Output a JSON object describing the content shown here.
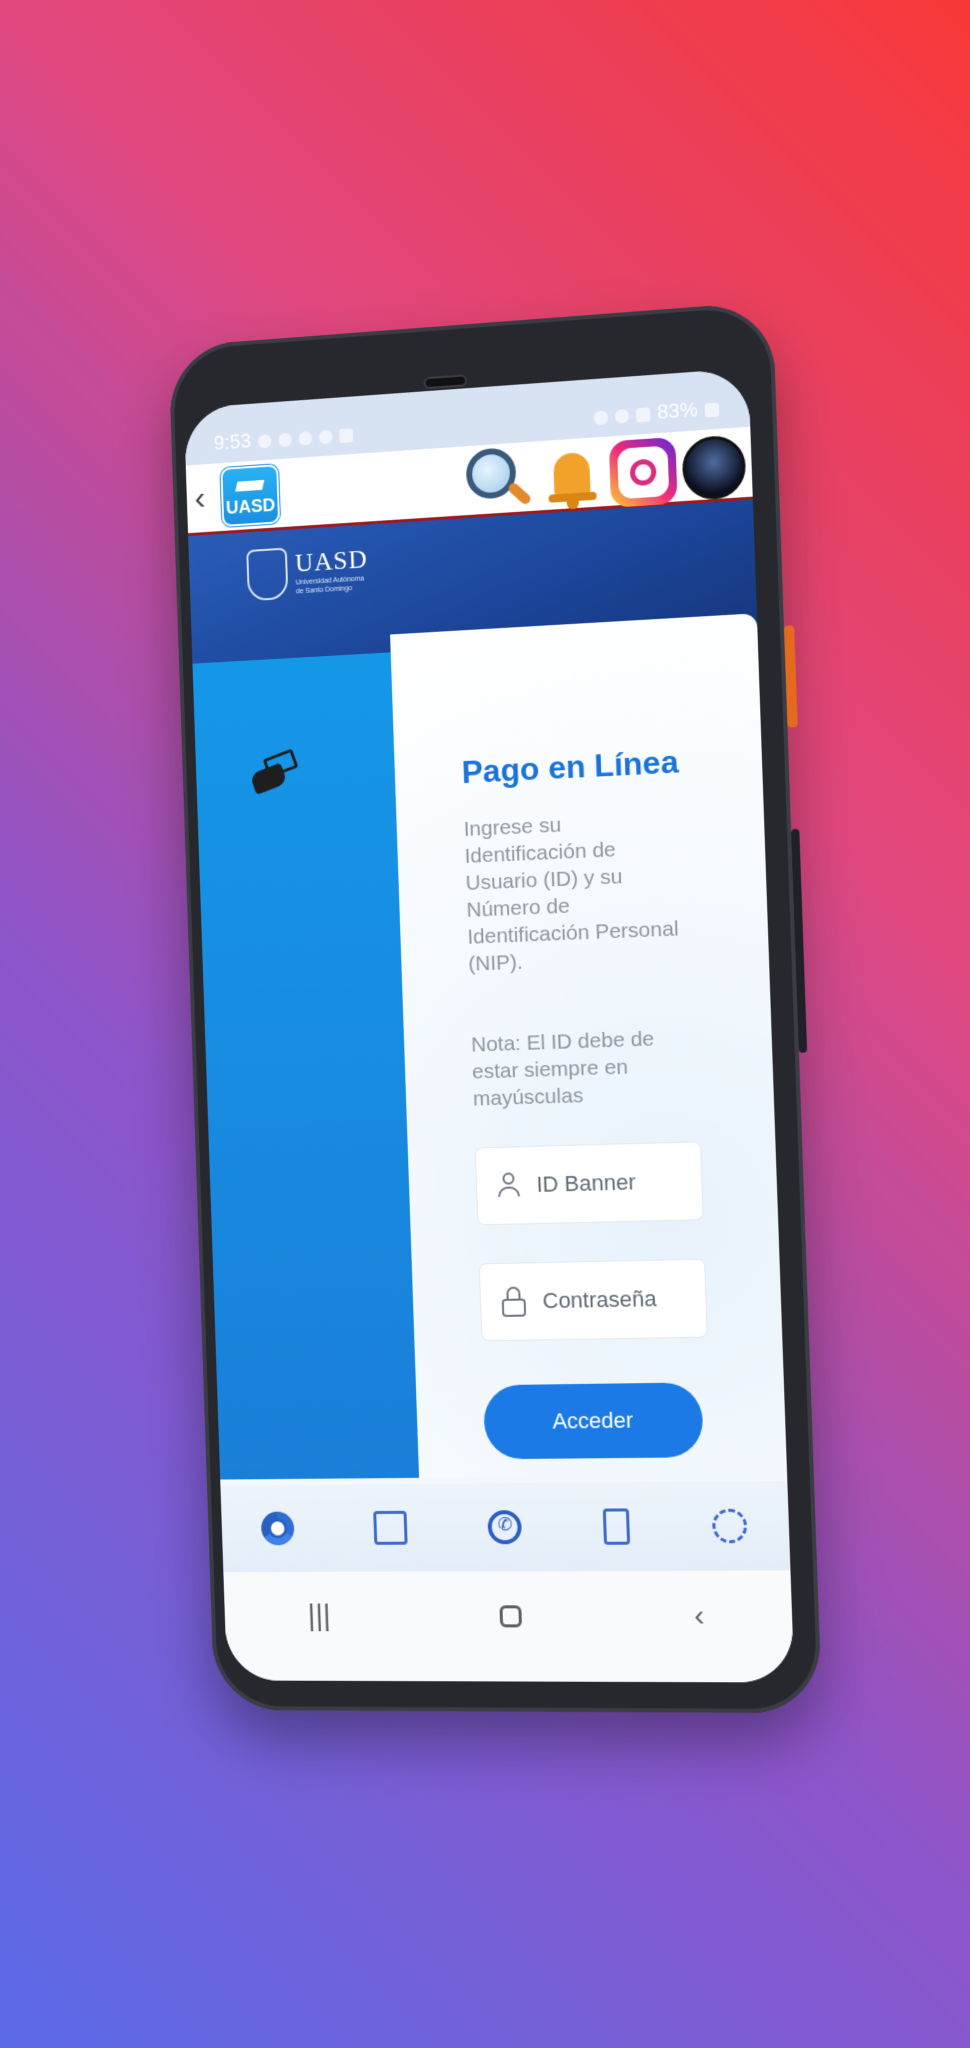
{
  "status_bar": {
    "time": "9:53",
    "battery": "83%"
  },
  "app_bar": {
    "app_logo_text": "UASD"
  },
  "banner": {
    "brand": "UASD",
    "subtitle_line1": "Universidad Autónoma",
    "subtitle_line2": "de Santo Domingo"
  },
  "login": {
    "title": "Pago en Línea",
    "description": "Ingrese su Identificación de Usuario (ID) y su Número de Identificación Personal (NIP).",
    "note": "Nota: El ID debe de estar siempre en mayúsculas",
    "id_placeholder": "ID Banner",
    "password_placeholder": "Contraseña",
    "submit_label": "Acceder"
  },
  "bottom_nav": {
    "items": [
      "chrome-icon",
      "store-icon",
      "whatsapp-icon",
      "calculator-icon",
      "documents-icon"
    ]
  },
  "colors": {
    "accent": "#1b7ae6",
    "title_blue": "#1a73d9",
    "banner_blue": "#1b4598",
    "appbar_border": "#9a1b1f"
  }
}
